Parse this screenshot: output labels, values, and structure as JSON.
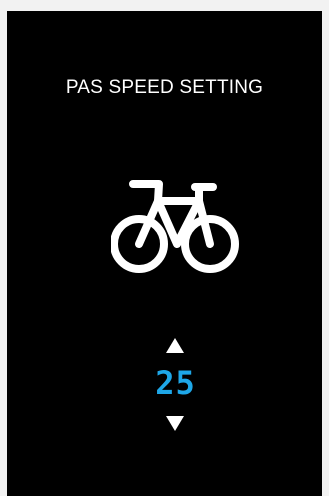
{
  "screen": {
    "title": "PAS SPEED SETTING",
    "icon": "bicycle-icon",
    "speed_value": "25",
    "up_icon": "arrow-up-icon",
    "down_icon": "arrow-down-icon"
  },
  "colors": {
    "background": "#000000",
    "text": "#ffffff",
    "value": "#1ea7e8"
  }
}
